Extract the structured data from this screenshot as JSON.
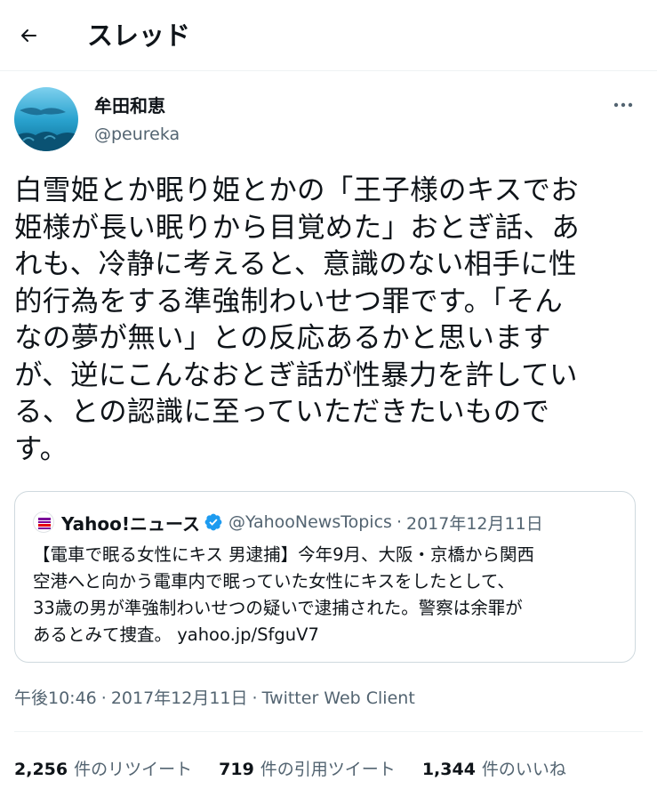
{
  "header": {
    "title": "スレッド",
    "back_icon": "arrow-left-icon"
  },
  "author": {
    "display_name": "牟田和恵",
    "handle": "@peureka"
  },
  "tweet": {
    "lines": [
      "白雪姫とか眠り姫とかの「王子様のキスでお",
      "姫様が長い眠りから目覚めた」おとぎ話、あ",
      "れも、冷静に考えると、意識のない相手に性",
      "的行為をする準強制わいせつ罪です。「そん",
      "なの夢が無い」との反応あるかと思います",
      "が、逆にこんなおとぎ話が性暴力を許してい",
      "る、との認識に至っていただきたいもので",
      "す。"
    ]
  },
  "quote": {
    "name": "Yahoo!ニュース",
    "handle": "@YahooNewsTopics",
    "separator": "·",
    "date": "2017年12月11日",
    "lines": [
      "【電車で眠る女性にキス 男逮捕】今年9月、大阪・京橋から関西",
      "空港へと向かう電車内で眠っていた女性にキスをしたとして、",
      "33歳の男が準強制わいせつの疑いで逮捕された。警察は余罪が",
      "あるとみて捜査。 yahoo.jp/SfguV7"
    ]
  },
  "meta": {
    "time": "午後10:46",
    "sep1": "·",
    "date": "2017年12月11日",
    "sep2": "·",
    "client": "Twitter Web Client"
  },
  "stats": {
    "retweets": {
      "count": "2,256",
      "label": "件のリツイート"
    },
    "quotes": {
      "count": "719",
      "label": "件の引用ツイート"
    },
    "likes": {
      "count": "1,344",
      "label": "件のいいね"
    }
  },
  "colors": {
    "text": "#0f1419",
    "secondary": "#536471",
    "border": "#cfd9de",
    "verified": "#1d9bf0",
    "yahoo_red": "#e60012"
  }
}
